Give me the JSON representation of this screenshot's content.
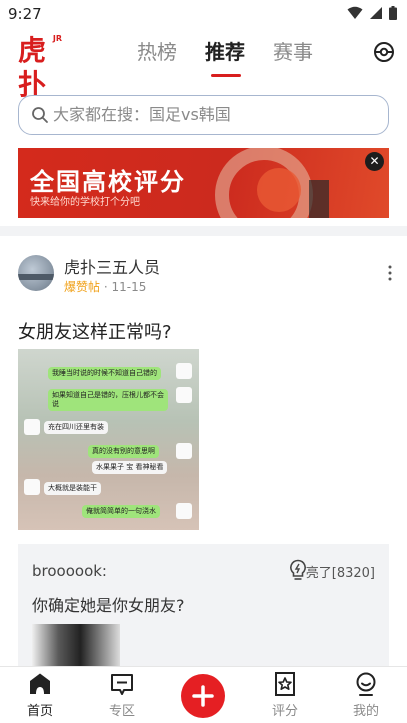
{
  "status_bar": {
    "time": "9:27"
  },
  "header": {
    "logo_text": "虎扑",
    "logo_badge": "JR",
    "tabs": [
      {
        "label": "热榜",
        "active": false
      },
      {
        "label": "推荐",
        "active": true
      },
      {
        "label": "赛事",
        "active": false
      }
    ]
  },
  "search": {
    "placeholder": "大家都在搜：国足vs韩国"
  },
  "banner": {
    "title": "全国高校评分",
    "subtitle": "快来给你的学校打个分吧"
  },
  "post": {
    "author": "虎扑三五人员",
    "tag": "爆赞帖",
    "date": "11-15",
    "title": "女朋友这样正常吗?",
    "image_chat": [
      "我睡当时说的时候不知道自己错的",
      "如果知道自己是错的，压根儿都不会说",
      "充在四川还里有装",
      "真的没有别的意思啊",
      "水果果子 宝 看神秘看",
      "大概就是装能干",
      "俺就简简单的一句浇水"
    ]
  },
  "comment": {
    "user": "broooook:",
    "light_label": "亮了[8320]",
    "text": "你确定她是你女朋友?"
  },
  "bottom_nav": [
    {
      "label": "首页",
      "icon": "home-icon",
      "active": true
    },
    {
      "label": "专区",
      "icon": "zone-icon",
      "active": false
    },
    {
      "label": "评分",
      "icon": "rating-icon",
      "active": false
    },
    {
      "label": "我的",
      "icon": "profile-icon",
      "active": false
    }
  ],
  "colors": {
    "brand": "#d81e1e",
    "tag": "#f0a017",
    "plus": "#e51f23"
  }
}
